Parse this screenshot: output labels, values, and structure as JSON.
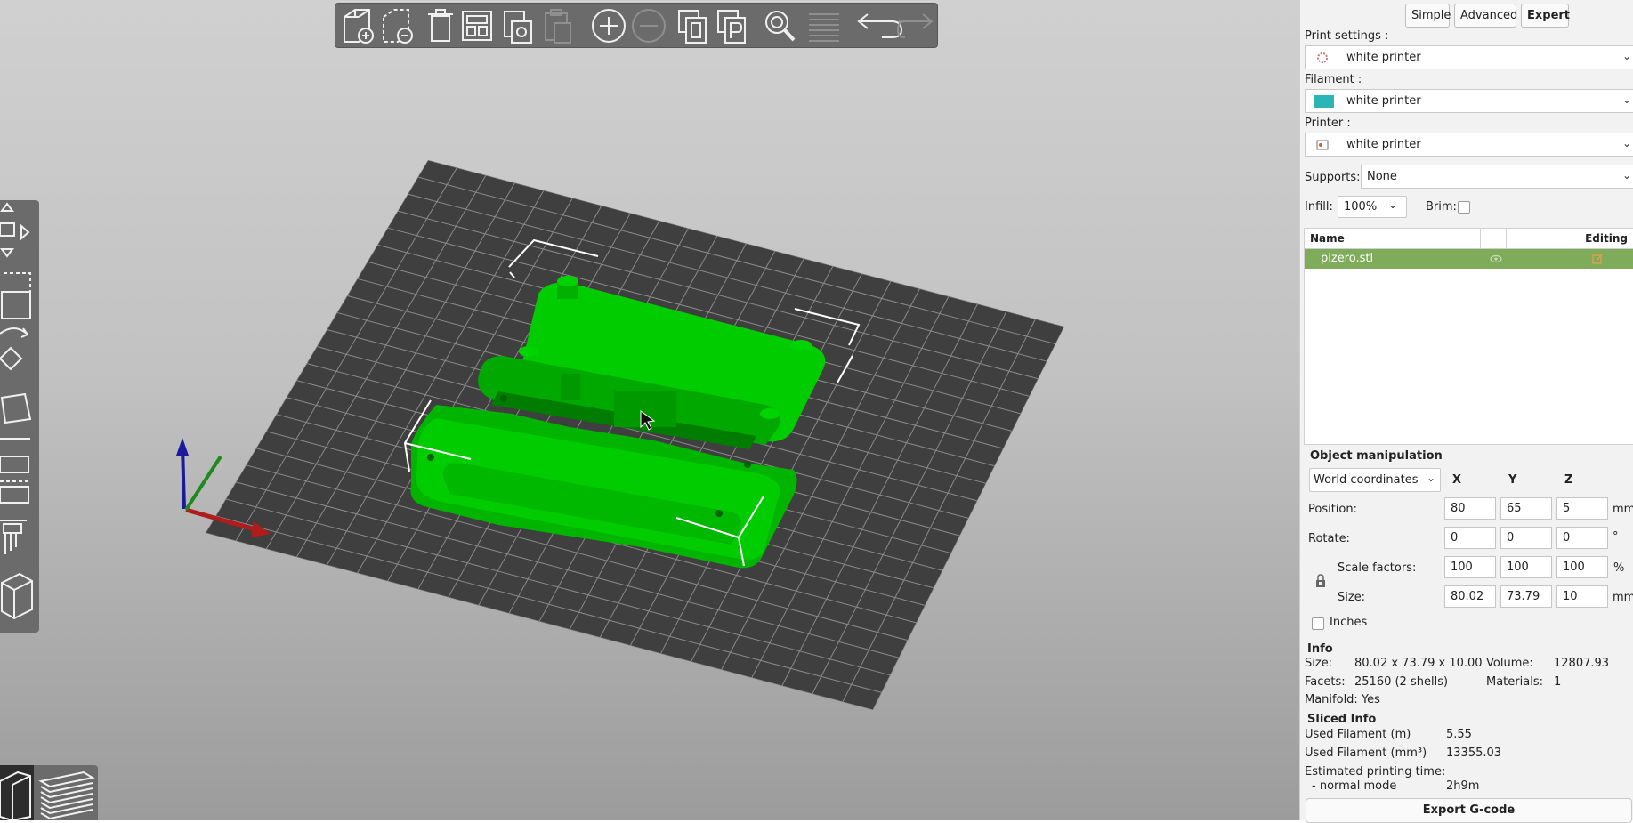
{
  "sidebar": {
    "modes": [
      "Simple",
      "Advanced",
      "Expert"
    ],
    "active_mode": "Expert",
    "print_settings_label": "Print settings :",
    "print_settings_value": "white printer",
    "filament_label": "Filament :",
    "filament_value": "white printer",
    "filament_color": "#2bb5b5",
    "printer_label": "Printer :",
    "printer_value": "white printer",
    "supports_label": "Supports:",
    "supports_value": "None",
    "infill_label": "Infill:",
    "infill_value": "100%",
    "brim_label": "Brim:"
  },
  "object_list": {
    "col_name": "Name",
    "col_editing": "Editing",
    "rows": [
      {
        "name": "pizero.stl"
      }
    ]
  },
  "manipulation": {
    "title": "Object manipulation",
    "coord_system": "World coordinates",
    "axes": [
      "X",
      "Y",
      "Z"
    ],
    "position_label": "Position:",
    "position": [
      "80",
      "65",
      "5"
    ],
    "position_unit": "mm",
    "rotate_label": "Rotate:",
    "rotate": [
      "0",
      "0",
      "0"
    ],
    "rotate_unit": "°",
    "scale_label": "Scale factors:",
    "scale": [
      "100",
      "100",
      "100"
    ],
    "scale_unit": "%",
    "size_label": "Size:",
    "size": [
      "80.02",
      "73.79",
      "10"
    ],
    "size_unit": "mm",
    "inches_label": "Inches"
  },
  "info": {
    "title": "Info",
    "size_label": "Size:",
    "size_value": "80.02 x 73.79 x 10.00",
    "volume_label": "Volume:",
    "volume_value": "12807.93",
    "facets_label": "Facets:",
    "facets_value": "25160 (2 shells)",
    "materials_label": "Materials:",
    "materials_value": "1",
    "manifold": "Manifold: Yes"
  },
  "sliced": {
    "title": "Sliced Info",
    "filament_m_label": "Used Filament (m)",
    "filament_m_value": "5.55",
    "filament_mm3_label": "Used Filament (mm³)",
    "filament_mm3_value": "13355.03",
    "print_time_label": "Estimated printing time:",
    "normal_mode_label": "- normal mode",
    "normal_mode_value": "2h9m"
  },
  "export_label": "Export G-code",
  "toolbar_icons": [
    "add-icon",
    "delete-icon",
    "delete-all-icon",
    "arrange-icon",
    "copy-icon",
    "paste-icon",
    "instance-add-icon",
    "instance-remove-icon",
    "split-objects-icon",
    "split-parts-icon",
    "search-icon",
    "layers-editing-icon",
    "undo-icon",
    "redo-icon"
  ],
  "colors": {
    "model": "#00cc00",
    "bed": "#3f3f3f",
    "selected_row": "#7fac5a"
  }
}
